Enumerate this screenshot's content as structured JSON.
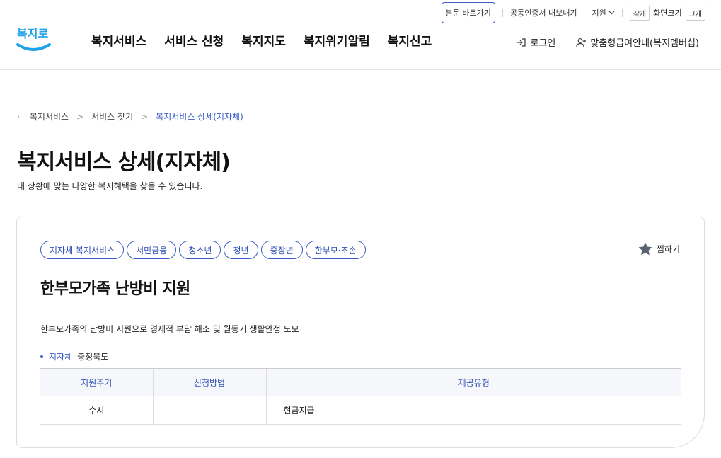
{
  "utility": {
    "skip_link": "본문 바로가기",
    "cert_export": "공동인증서 내보내기",
    "lang": "지원",
    "zoom_small": "작게",
    "zoom_label": "화면크기",
    "zoom_large": "크게"
  },
  "logo_text": "복지로",
  "gnb": [
    "복지서비스",
    "서비스 신청",
    "복지지도",
    "복지위기알림",
    "복지신고"
  ],
  "header_right": {
    "login": "로그인",
    "membership": "맞춤형급여안내(복지멤버십)"
  },
  "breadcrumb": [
    "복지서비스",
    "서비스 찾기",
    "복지서비스 상세(지자체)"
  ],
  "page": {
    "title": "복지서비스 상세(지자체)",
    "subtitle": "내 상황에 맞는 다양한 복지혜택을 찾을 수 있습니다."
  },
  "service": {
    "tags": [
      "지자체 복지서비스",
      "서민금융",
      "청소년",
      "청년",
      "중장년",
      "한부모·조손"
    ],
    "bookmark": "찜하기",
    "title": "한부모가족 난방비 지원",
    "description": "한부모가족의 난방비 지원으로 경제적 부담 해소 및 월동기 생활안정 도모",
    "org_label": "지자체",
    "org_value": "충청북도",
    "table": {
      "headers": [
        "지원주기",
        "신청방법",
        "제공유형"
      ],
      "row": [
        "수시",
        "-",
        "현금지급"
      ]
    }
  },
  "colors": {
    "accent": "#3a5bc7",
    "logo": "#1fa3e8"
  }
}
